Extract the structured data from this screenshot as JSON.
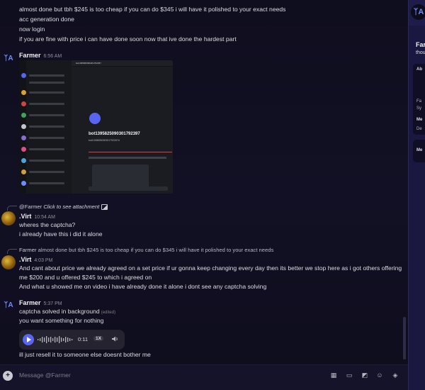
{
  "messages_top": [
    "almost done but tbh $245 is too cheap if you can do $345 i will have it polished to your exact needs",
    "acc generation done",
    "now login",
    "if you are fine with price i can have done soon now that ive done the hardest part"
  ],
  "msg_farmer_1": {
    "author": "Farmer",
    "time": "6:56 AM"
  },
  "attachment": {
    "bot_name": "bot1395825090301792397",
    "bot_sub": "bot1395825090301792397#",
    "title_text": "bot1395825090301792397"
  },
  "msg_virt_1": {
    "reply_user": "@Farmer",
    "reply_text": "Click to see attachment",
    "author": ".Virt",
    "time": "10:54 AM",
    "lines": [
      "wheres the captcha?",
      "i already have this i did it alone"
    ]
  },
  "msg_virt_2": {
    "reply_user": "Farmer",
    "reply_text": "almost done but tbh $245 is too cheap if you can do $345 i will have it polished to your exact needs",
    "author": ".Virt",
    "time": "4:03 PM",
    "lines": [
      "And cant about price we already agreed on a set price if ur gonna keep changing every day then its better we stop here as i got others offering",
      "me $200 and u offered $245 to which i agreed on",
      "And what u showed me on video i have already done it alone i dont see any captcha solving"
    ]
  },
  "msg_farmer_2": {
    "author": "Farmer",
    "time": "5:37 PM",
    "line1": "captcha solved in background",
    "edited": "(edited)",
    "line2": "you want something for nothing",
    "voice": {
      "duration": "0:11",
      "speed": "1X"
    },
    "line3": "ill just resell it to someone else doesnt bother me"
  },
  "composer": {
    "placeholder": "Message @Farmer"
  },
  "profile": {
    "name": "Far",
    "username": "thou",
    "about_label": "Ab",
    "fa": "Fa",
    "sy": "Sy",
    "me": "Me",
    "de": "De",
    "me2": "Me"
  },
  "colors": {
    "accent": "#5865f2",
    "background": "#0f0e1e",
    "panel": "#1a1840"
  }
}
